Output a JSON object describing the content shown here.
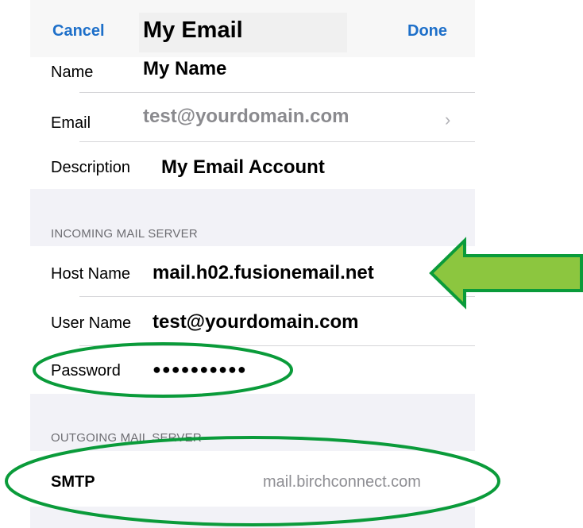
{
  "navbar": {
    "cancel_label": "Cancel",
    "title": "My Email",
    "done_label": "Done"
  },
  "account": {
    "name_label": "Name",
    "name_value": "My Name",
    "email_label": "Email",
    "email_value": "test@yourdomain.com",
    "description_label": "Description",
    "description_value": "My Email Account"
  },
  "incoming": {
    "header": "INCOMING MAIL SERVER",
    "host_label": "Host Name",
    "host_value": "mail.h02.fusionemail.net",
    "user_label": "User Name",
    "user_value": "test@yourdomain.com",
    "password_label": "Password",
    "password_value": "●●●●●●●●●●"
  },
  "outgoing": {
    "header": "OUTGOING MAIL SERVER",
    "smtp_label": "SMTP",
    "smtp_value": "mail.birchconnect.com"
  },
  "annotation_color": "#0a9b3a",
  "arrow_fill": "#8cc63f",
  "icons": {
    "email_row": "chevron-right-icon"
  }
}
